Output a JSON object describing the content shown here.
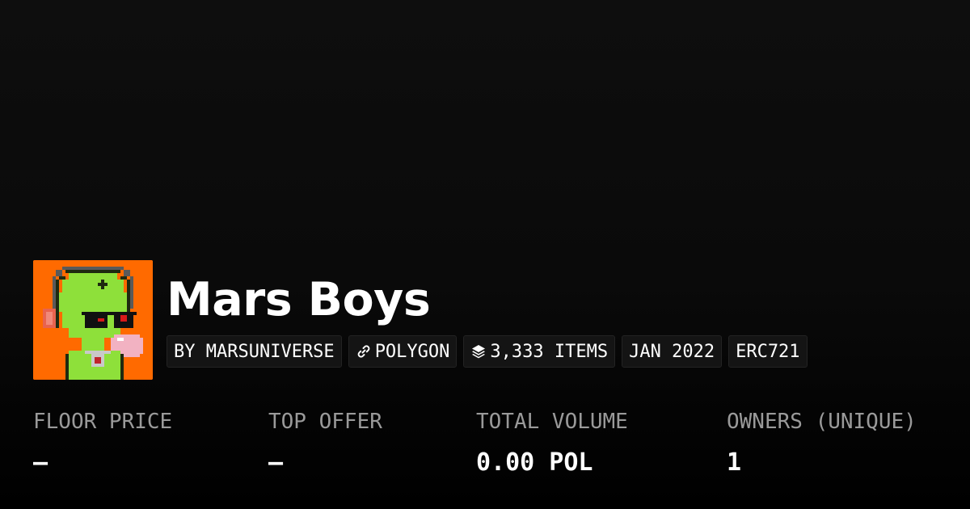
{
  "collection": {
    "name": "Mars Boys",
    "avatar_alt": "Mars Boys collection avatar"
  },
  "tags": [
    {
      "label": "BY MARSUNIVERSE",
      "icon": ""
    },
    {
      "label": "POLYGON",
      "icon": "chain-link-icon"
    },
    {
      "label": "3,333 ITEMS",
      "icon": "layers-icon"
    },
    {
      "label": "JAN 2022",
      "icon": ""
    },
    {
      "label": "ERC721",
      "icon": ""
    }
  ],
  "stats": [
    {
      "label": "FLOOR PRICE",
      "value": "–"
    },
    {
      "label": "TOP OFFER",
      "value": "–"
    },
    {
      "label": "TOTAL VOLUME",
      "value": "0.00 POL"
    },
    {
      "label": "OWNERS (UNIQUE)",
      "value": "1"
    }
  ],
  "colors": {
    "background": "#0a0a0a",
    "avatar_background": "#ff6a00",
    "label_gray": "#9a9a9a",
    "tag_background": "#141414"
  }
}
